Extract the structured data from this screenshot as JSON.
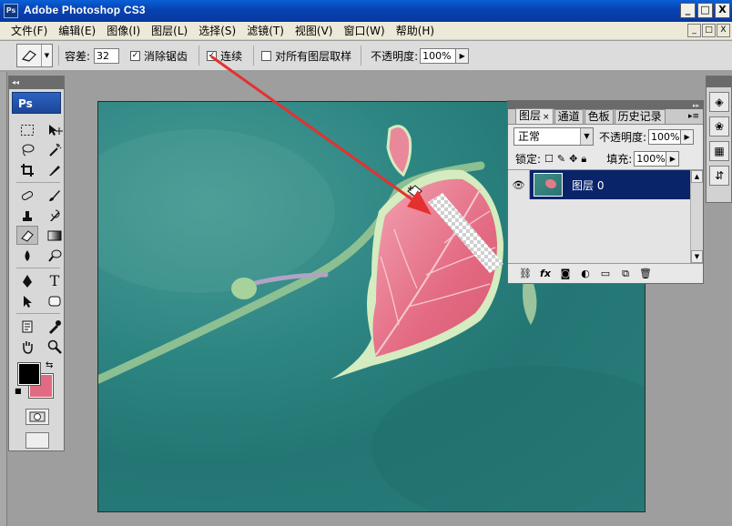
{
  "app": {
    "logo": "Ps",
    "title": "Adobe Photoshop CS3",
    "window_buttons": [
      "_",
      "□",
      "X"
    ]
  },
  "menu": [
    "文件(F)",
    "编辑(E)",
    "图像(I)",
    "图层(L)",
    "选择(S)",
    "滤镜(T)",
    "视图(V)",
    "窗口(W)",
    "帮助(H)"
  ],
  "mdi_buttons": [
    "_",
    "□",
    "X"
  ],
  "options": {
    "tolerance_label": "容差:",
    "tolerance_value": "32",
    "antialias_label": "消除锯齿",
    "antialias_checked": "✓",
    "contiguous_label": "连续",
    "contiguous_checked": "✓",
    "sample_all_label": "对所有图层取样",
    "opacity_label": "不透明度:",
    "opacity_value": "100%"
  },
  "toolbox": {
    "header": "Ps"
  },
  "colors": {
    "foreground": "#000000",
    "background": "#e06b82",
    "selection_highlight": "#0a246a",
    "annotation_arrow": "#e53030"
  },
  "layers_panel": {
    "tabs": [
      {
        "label": "图层",
        "active": true
      },
      {
        "label": "通道",
        "active": false
      },
      {
        "label": "色板",
        "active": false
      },
      {
        "label": "历史记录",
        "active": false
      }
    ],
    "tab_close": "×",
    "blend_mode": "正常",
    "opacity_label": "不透明度:",
    "opacity_value": "100%",
    "lock_label": "锁定:",
    "fill_label": "填充:",
    "fill_value": "100%",
    "layers": [
      {
        "name": "图层 0",
        "visible": true,
        "selected": true
      }
    ],
    "bottom_icons": [
      "link-icon",
      "fx-icon",
      "mask-icon",
      "adjustment-icon",
      "group-icon",
      "new-layer-icon",
      "trash-icon"
    ],
    "fx_label": "fx"
  },
  "right_dock": {
    "icons": [
      "layers-dock-icon",
      "channels-dock-icon",
      "swatches-dock-icon",
      "history-dock-icon"
    ]
  }
}
